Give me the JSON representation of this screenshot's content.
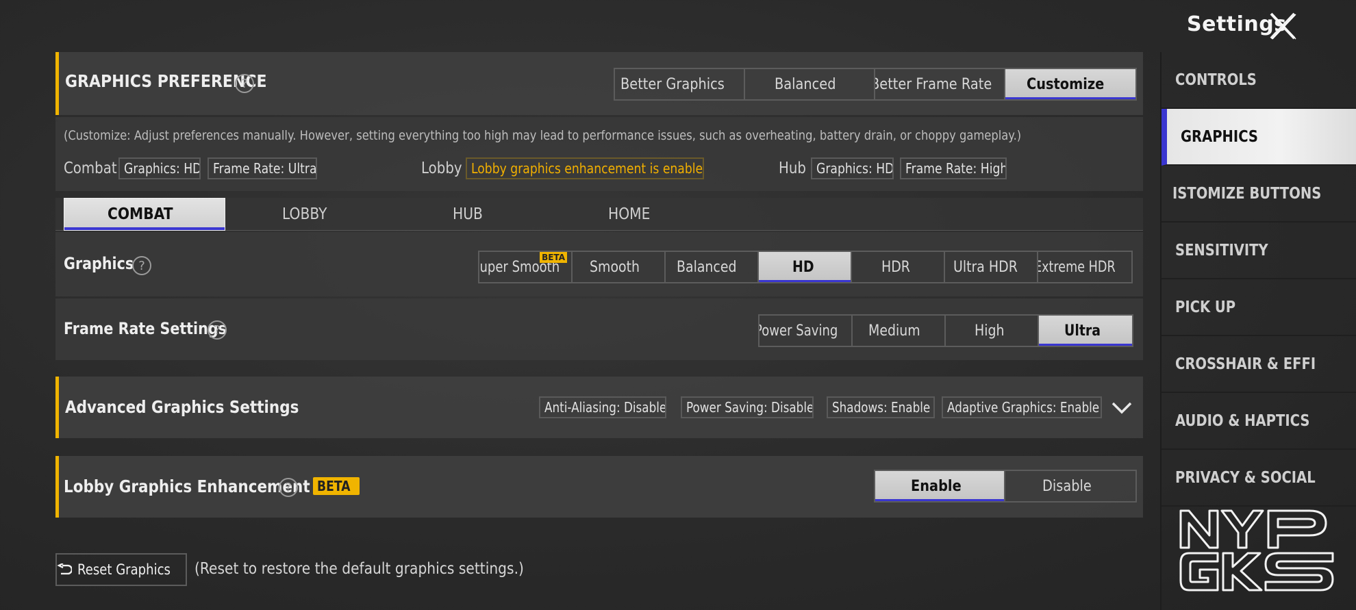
{
  "header": {
    "title": "Settings"
  },
  "sidebar": {
    "items": [
      {
        "label": "CONTROLS",
        "active": false
      },
      {
        "label": "GRAPHICS",
        "active": true
      },
      {
        "label": "ISTOMIZE BUTTONS",
        "active": false
      },
      {
        "label": "SENSITIVITY",
        "active": false
      },
      {
        "label": "PICK UP",
        "active": false
      },
      {
        "label": "CROSSHAIR & EFFI",
        "active": false
      },
      {
        "label": "AUDIO & HAPTICS",
        "active": false
      },
      {
        "label": "PRIVACY & SOCIAL",
        "active": false
      }
    ]
  },
  "preference": {
    "title": "GRAPHICS PREFERENCE",
    "options": [
      "Better Graphics",
      "Balanced",
      "Better Frame Rate",
      "Customize"
    ],
    "selected": "Customize",
    "note": "(Customize: Adjust preferences manually. However, setting everything too high may lead to performance issues, such as overheating, battery drain, or choppy gameplay.)"
  },
  "summary": {
    "combat_label": "Combat",
    "combat_graphics": "Graphics: HD",
    "combat_framerate": "Frame Rate: Ultra",
    "lobby_label": "Lobby",
    "lobby_status": "Lobby graphics enhancement is enabled.",
    "hub_label": "Hub",
    "hub_graphics": "Graphics: HD",
    "hub_framerate": "Frame Rate: High"
  },
  "tabs": [
    "COMBAT",
    "LOBBY",
    "HUB",
    "HOME"
  ],
  "active_tab": "COMBAT",
  "graphics": {
    "label": "Graphics",
    "options": [
      "Super Smooth",
      "Smooth",
      "Balanced",
      "HD",
      "HDR",
      "Ultra HDR",
      "Extreme HDR"
    ],
    "selected": "HD",
    "beta_label": "BETA"
  },
  "framerate": {
    "label": "Frame Rate Settings",
    "options": [
      "Power Saving",
      "Medium",
      "High",
      "Ultra"
    ],
    "selected": "Ultra"
  },
  "advanced": {
    "title": "Advanced Graphics Settings",
    "chips": [
      "Anti-Aliasing: Disable",
      "Power Saving: Disable",
      "Shadows: Enable",
      "Adaptive Graphics: Enable"
    ]
  },
  "lobby_enh": {
    "title": "Lobby Graphics Enhancement",
    "beta": "BETA",
    "options": [
      "Enable",
      "Disable"
    ],
    "selected": "Enable"
  },
  "reset": {
    "label": "Reset Graphics",
    "note": "(Reset to restore the default graphics settings.)"
  },
  "help_glyph": "?",
  "watermark": "NYP GKS",
  "colors": {
    "accent": "#f0b400",
    "selected_underline": "#3a36d0"
  }
}
